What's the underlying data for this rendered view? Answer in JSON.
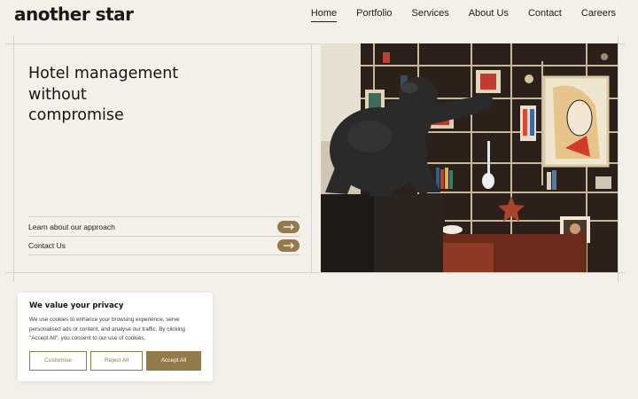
{
  "brand": {
    "logo": "another star"
  },
  "nav": {
    "items": [
      {
        "label": "Home",
        "active": true
      },
      {
        "label": "Portfolio"
      },
      {
        "label": "Services"
      },
      {
        "label": "About Us"
      },
      {
        "label": "Contact"
      },
      {
        "label": "Careers"
      }
    ]
  },
  "hero": {
    "title_lines": [
      "Hotel management",
      "without",
      "compromise"
    ],
    "links": [
      {
        "label": "Learn about our approach",
        "icon": "arrow-right-icon"
      },
      {
        "label": "Contact Us",
        "icon": "arrow-right-icon"
      }
    ]
  },
  "cookie": {
    "title": "We value your privacy",
    "text": "We use cookies to enhance your browsing experience, serve personalised ads or content, and analyse our traffic. By clicking \"Accept All\", you consent to our use of cookies.",
    "buttons": {
      "customise": "Customise",
      "reject": "Reject All",
      "accept": "Accept All"
    }
  },
  "colors": {
    "background": "#f2f0e8",
    "accent": "#94794b",
    "text": "#1c1c1c",
    "frame": "#d6d3c8"
  }
}
